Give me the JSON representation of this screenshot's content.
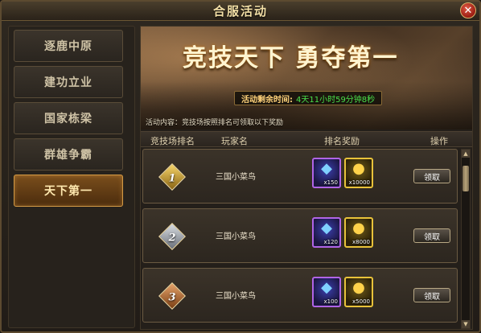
{
  "window": {
    "title": "合服活动",
    "close_icon": "close-icon"
  },
  "sidebar": {
    "items": [
      {
        "label": "逐鹿中原",
        "active": false
      },
      {
        "label": "建功立业",
        "active": false
      },
      {
        "label": "国家栋梁",
        "active": false
      },
      {
        "label": "群雄争霸",
        "active": false
      },
      {
        "label": "天下第一",
        "active": true
      }
    ]
  },
  "banner": {
    "headline": "竞技天下 勇夺第一",
    "timer_label": "活动剩余时间:",
    "timer_value": "4天11小时59分钟8秒",
    "description": "活动内容：竞技场按照排名可领取以下奖励"
  },
  "table": {
    "headers": {
      "rank": "竞技场排名",
      "player": "玩家名",
      "reward": "排名奖励",
      "action": "操作"
    },
    "rows": [
      {
        "rank": "1",
        "player": "三国小菜鸟",
        "gem_qty": "x150",
        "gold_qty": "x10000",
        "button": "领取"
      },
      {
        "rank": "2",
        "player": "三国小菜鸟",
        "gem_qty": "x120",
        "gold_qty": "x8000",
        "button": "领取"
      },
      {
        "rank": "3",
        "player": "三国小菜鸟",
        "gem_qty": "x100",
        "gold_qty": "x5000",
        "button": "领取"
      }
    ]
  },
  "colors": {
    "accent": "#d49a45",
    "timer_value": "#49e04a",
    "gem_border": "#b064e6",
    "gold_border": "#e8c23a"
  }
}
